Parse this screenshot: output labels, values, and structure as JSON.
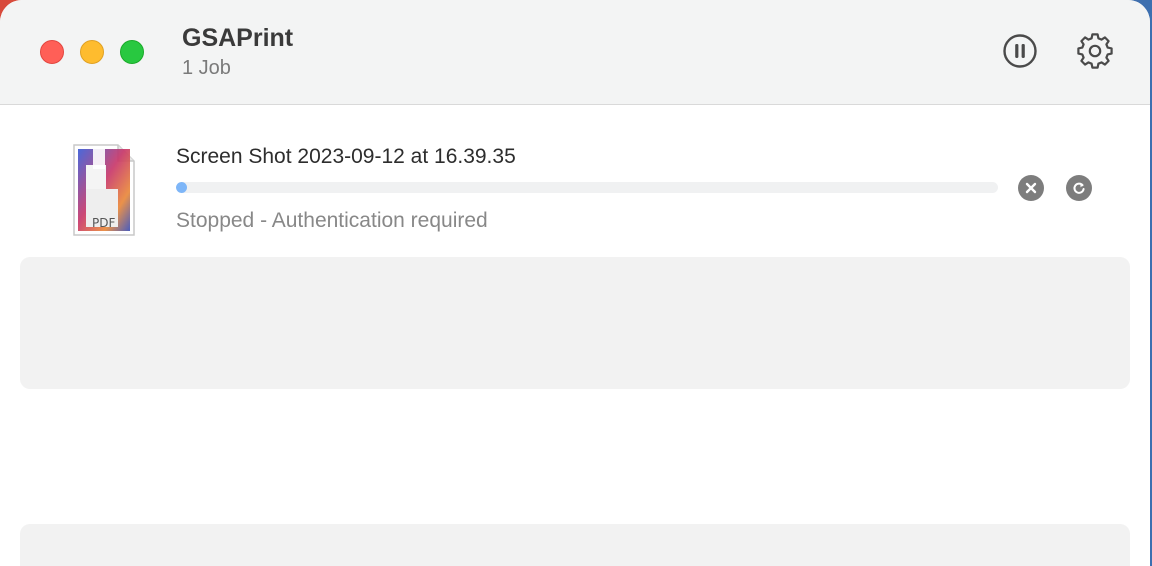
{
  "window": {
    "title": "GSAPrint",
    "subtitle": "1 Job"
  },
  "toolbar": {
    "pause_icon": "pause-circle-icon",
    "settings_icon": "gear-icon"
  },
  "jobs": [
    {
      "name": "Screen Shot 2023-09-12 at 16.39.35",
      "status": "Stopped - Authentication required",
      "progress": 0.01,
      "file_icon": "pdf-document-icon",
      "file_badge": "PDF",
      "actions": [
        "cancel-icon",
        "retry-icon"
      ]
    }
  ],
  "colors": {
    "close": "#ff5f57",
    "minimize": "#febc2e",
    "maximize": "#28c840",
    "progress": "#7eb6f8"
  }
}
